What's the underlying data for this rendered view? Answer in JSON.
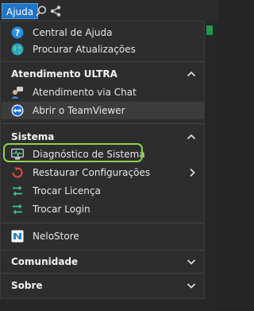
{
  "menubar": {
    "active_menu": "Ajuda"
  },
  "menu": {
    "top_items": [
      {
        "label": "Central de Ajuda",
        "icon": "help-circle-icon"
      },
      {
        "label": "Procurar Atualizações",
        "icon": "globe-icon"
      }
    ],
    "atendimento": {
      "title": "Atendimento ULTRA",
      "expanded": true,
      "items": [
        {
          "label": "Atendimento via Chat",
          "icon": "chat-agent-icon"
        },
        {
          "label": "Abrir o TeamViewer",
          "icon": "teamviewer-icon"
        }
      ]
    },
    "sistema": {
      "title": "Sistema",
      "expanded": true,
      "items": [
        {
          "label": "Diagnóstico de Sistema",
          "icon": "monitor-pulse-icon",
          "highlighted": true
        },
        {
          "label": "Restaurar Configurações",
          "icon": "restore-icon",
          "has_submenu": true
        },
        {
          "label": "Trocar Licença",
          "icon": "swap-arrows-icon"
        },
        {
          "label": "Trocar Login",
          "icon": "swap-arrows-icon"
        }
      ]
    },
    "nelostore": {
      "label": "NeloStore",
      "icon": "nelostore-icon"
    },
    "comunidade": {
      "title": "Comunidade",
      "expanded": false
    },
    "sobre": {
      "title": "Sobre",
      "expanded": false
    }
  },
  "colors": {
    "menu_bg": "#2d2d2d",
    "accent_blue": "#1f74c5",
    "highlight_green": "#8fd14f",
    "hover_bg": "#3c3c3c"
  }
}
